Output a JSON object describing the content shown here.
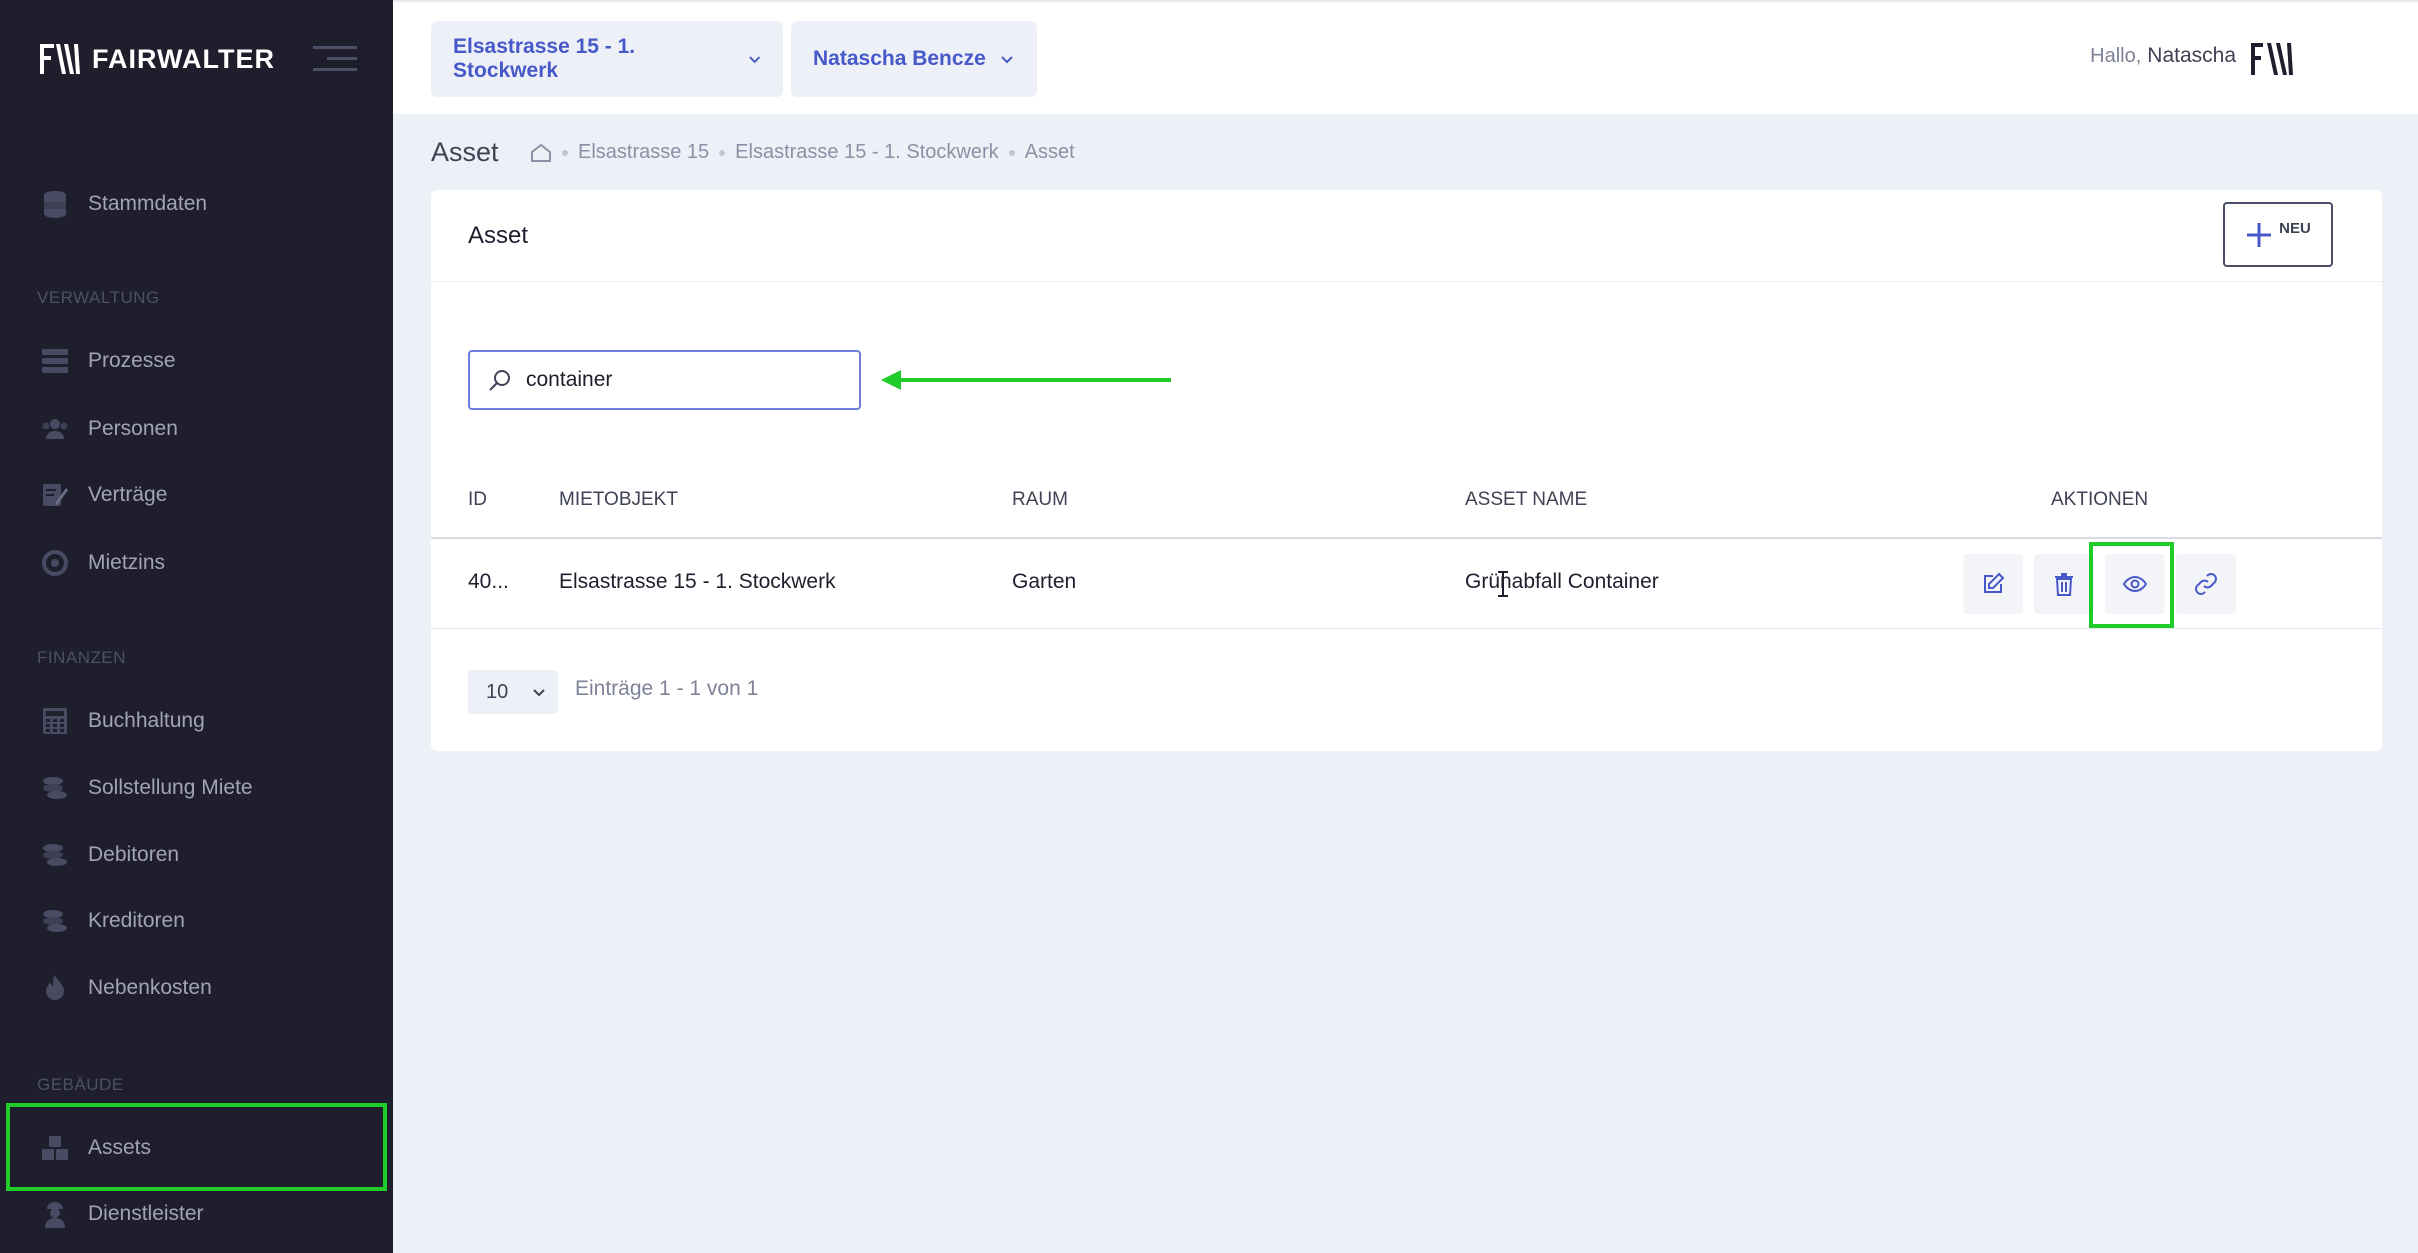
{
  "app": {
    "logo_text": "FAIRWALTER"
  },
  "sidebar": {
    "items_top": [
      {
        "label": "Stammdaten",
        "icon": "database-icon"
      }
    ],
    "sections": [
      {
        "label": "Verwaltung",
        "items": [
          {
            "label": "Prozesse",
            "icon": "server-icon"
          },
          {
            "label": "Personen",
            "icon": "users-icon"
          },
          {
            "label": "Verträge",
            "icon": "contract-icon"
          },
          {
            "label": "Mietzins",
            "icon": "rent-icon"
          }
        ]
      },
      {
        "label": "Finanzen",
        "items": [
          {
            "label": "Buchhaltung",
            "icon": "calculator-icon"
          },
          {
            "label": "Sollstellung Miete",
            "icon": "coins-icon"
          },
          {
            "label": "Debitoren",
            "icon": "coins-icon"
          },
          {
            "label": "Kreditoren",
            "icon": "coins-icon"
          },
          {
            "label": "Nebenkosten",
            "icon": "flame-icon"
          }
        ]
      },
      {
        "label": "Gebäude",
        "items": [
          {
            "label": "Assets",
            "icon": "boxes-icon",
            "active": true
          },
          {
            "label": "Dienstleister",
            "icon": "worker-icon"
          }
        ]
      }
    ]
  },
  "header": {
    "property_select": "Elsastrasse 15 - 1. Stockwerk",
    "person_select": "Natascha Bencze",
    "hello": "Hallo,",
    "user_name": "Natascha"
  },
  "subheader": {
    "title": "Asset",
    "breadcrumb": [
      "Elsastrasse 15",
      "Elsastrasse 15 - 1. Stockwerk",
      "Asset"
    ]
  },
  "card": {
    "title": "Asset",
    "new_button": "NEU",
    "search_value": "container",
    "columns": [
      "ID",
      "Mietobjekt",
      "Raum",
      "Asset Name",
      "Aktionen"
    ],
    "rows": [
      {
        "id": "40...",
        "mietobjekt": "Elsastrasse 15 - 1. Stockwerk",
        "raum": "Garten",
        "asset_name": "Grünabfall Container"
      }
    ],
    "actions": [
      "edit-icon",
      "trash-icon",
      "eye-icon",
      "link-icon"
    ],
    "page_size": "10",
    "pager_info": "Einträge 1 - 1 von 1"
  },
  "colors": {
    "sidebar_bg": "#1e1e2d",
    "accent": "#4758c9",
    "highlight": "#1fcc2a"
  }
}
